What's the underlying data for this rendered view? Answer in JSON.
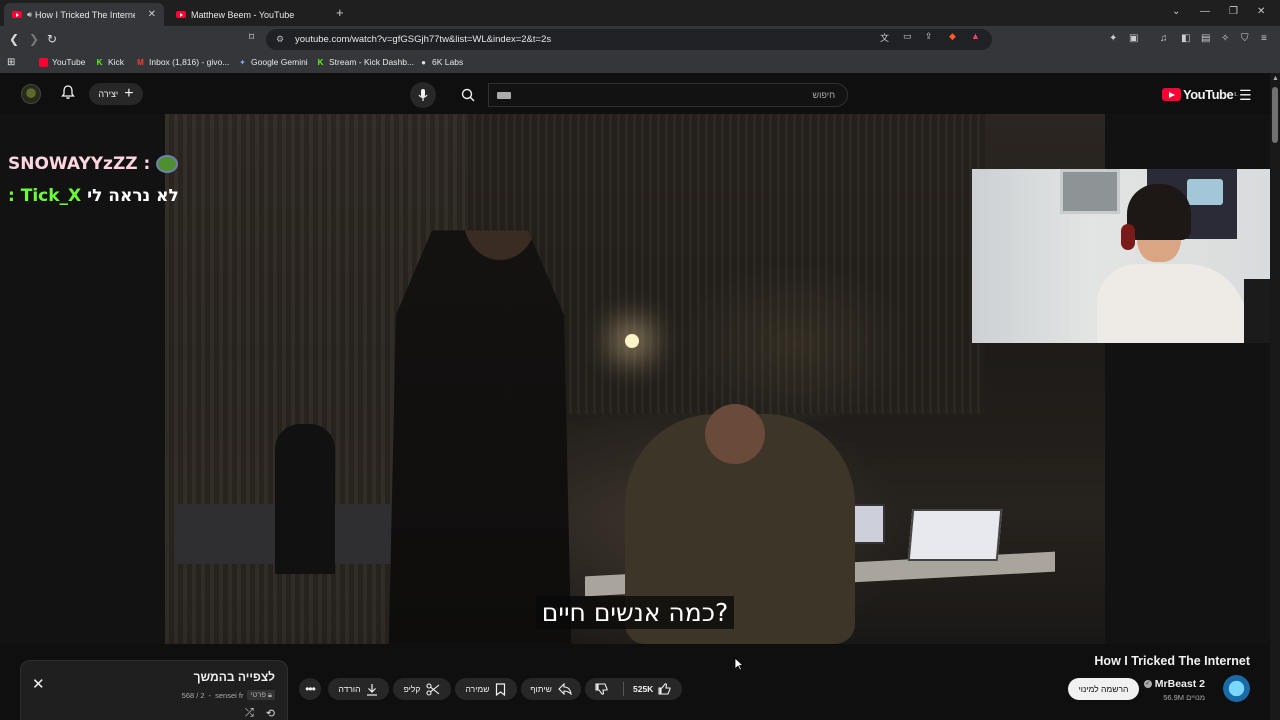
{
  "browser": {
    "tabs": [
      {
        "label": "How I Tricked The Internet - Y",
        "active": true
      },
      {
        "label": "Matthew Beem - YouTube",
        "active": false
      }
    ],
    "url": "youtube.com/watch?v=gfGSGjh77tw&list=WL&index=2&t=2s",
    "bookmarks": [
      {
        "label": "YouTube",
        "icon": "youtube-icon"
      },
      {
        "label": "Kick",
        "icon": "kick-icon"
      },
      {
        "label": "Inbox (1,816) - givo...",
        "icon": "gmail-icon"
      },
      {
        "label": "Google Gemini",
        "icon": "gemini-icon"
      },
      {
        "label": "Stream - Kick Dashb...",
        "icon": "kick-icon"
      },
      {
        "label": "6K Labs",
        "icon": "6k-icon"
      }
    ]
  },
  "youtube_header": {
    "create_label": "יצירה",
    "search_placeholder": "חיפוש",
    "logo_text": "YouTube",
    "logo_region": "IL"
  },
  "stream_overlay": {
    "chat": [
      {
        "user": "SNOWAYYzZZ :",
        "message": ""
      },
      {
        "user": ": Tick_X",
        "message": "לא נראה לי"
      }
    ]
  },
  "video": {
    "subtitle": "כמה אנשים חיים?",
    "title": "How I Tricked The Internet",
    "channel": "MrBeast 2",
    "subscribers": "56.9M מנויים",
    "subscribe_label": "הרשמה למינוי",
    "likes": "525K",
    "actions": {
      "share": "שיתוף",
      "save": "שמירה",
      "clip": "קליפ",
      "download": "הורדה"
    }
  },
  "playlist": {
    "title": "לצפייה בהמשך",
    "privacy": "פרטי",
    "owner": "sensei fr",
    "position": "568 / 2"
  },
  "colors": {
    "youtube_red": "#ff0033",
    "chat_user1": "#ffd6e0",
    "chat_user2": "#6bff3a",
    "page_bg": "#0f0f0f"
  }
}
